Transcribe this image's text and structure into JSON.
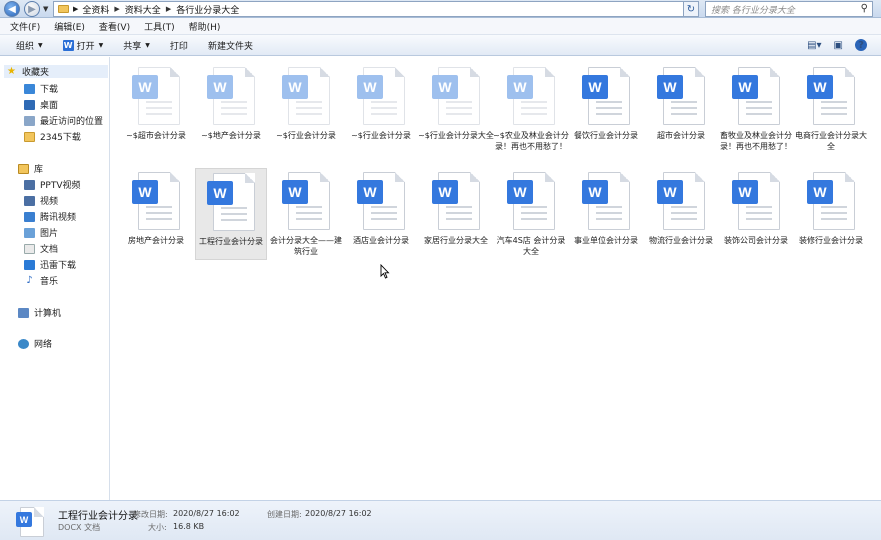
{
  "address": {
    "crumbs": [
      "全资料",
      "资料大全",
      "各行业分录大全"
    ],
    "search_placeholder": "搜索 各行业分录大全"
  },
  "menu": [
    "文件(F)",
    "编辑(E)",
    "查看(V)",
    "工具(T)",
    "帮助(H)"
  ],
  "toolbar": {
    "organize": "组织",
    "open": "打开",
    "share": "共享",
    "print": "打印",
    "new_folder": "新建文件夹"
  },
  "sidebar": {
    "favorites": "收藏夹",
    "downloads": "下载",
    "desktop": "桌面",
    "recent": "最近访问的位置",
    "dl2345": "2345下载",
    "library": "库",
    "pptv": "PPTV视频",
    "video": "视频",
    "tencent": "腾讯视频",
    "pictures": "图片",
    "docs": "文档",
    "xunlei": "迅雷下载",
    "music": "音乐",
    "computer": "计算机",
    "network": "网络"
  },
  "files": [
    {
      "label": "~$超市会计分录",
      "faded": true
    },
    {
      "label": "~$地产会计分录",
      "faded": true
    },
    {
      "label": "~$行业会计分录",
      "faded": true
    },
    {
      "label": "~$行业会计分录",
      "faded": true
    },
    {
      "label": "~$行业会计分录大全",
      "faded": true
    },
    {
      "label": "~$农业及林业会计分录！再也不用愁了！",
      "faded": true
    },
    {
      "label": "餐饮行业会计分录",
      "faded": false
    },
    {
      "label": "超市会计分录",
      "faded": false
    },
    {
      "label": "畜牧业及林业会计分录！再也不用愁了！",
      "faded": false
    },
    {
      "label": "电商行业会计分录大全",
      "faded": false
    },
    {
      "label": "房地产会计分录",
      "faded": false
    },
    {
      "label": "工程行业会计分录",
      "faded": false,
      "selected": true
    },
    {
      "label": "会计分录大全——建筑行业",
      "faded": false
    },
    {
      "label": "酒店业会计分录",
      "faded": false
    },
    {
      "label": "家居行业分录大全",
      "faded": false
    },
    {
      "label": "汽车4S店 会计分录大全",
      "faded": false
    },
    {
      "label": "事业单位会计分录",
      "faded": false
    },
    {
      "label": "物流行业会计分录",
      "faded": false
    },
    {
      "label": "装饰公司会计分录",
      "faded": false
    },
    {
      "label": "装修行业会计分录",
      "faded": false
    }
  ],
  "status": {
    "name": "工程行业会计分录",
    "type": "DOCX 文档",
    "modified_label": "修改日期:",
    "modified": "2020/8/27 16:02",
    "size_label": "大小:",
    "size": "16.8 KB",
    "created_label": "创建日期:",
    "created": "2020/8/27 16:02"
  },
  "icons": {
    "file": "word-document-icon",
    "badge_color": "#3478de",
    "badge_faded_color": "#9ec0ee"
  }
}
